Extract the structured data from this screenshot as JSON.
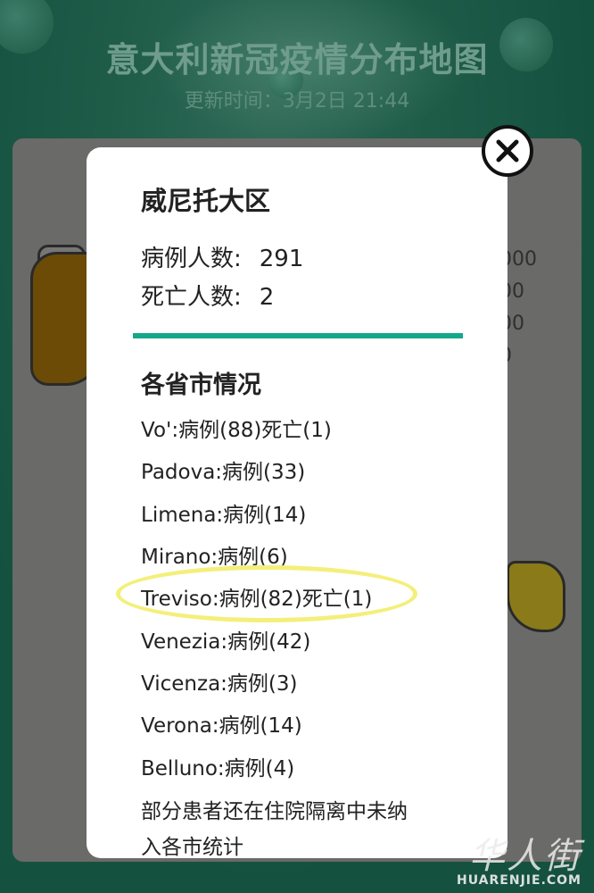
{
  "background": {
    "title": "意大利新冠疫情分布地图",
    "subtitle": "更新时间：3月2日 21:44",
    "legend_numbers": [
      "000",
      "00",
      "00",
      "0"
    ]
  },
  "modal": {
    "region_title": "威尼托大区",
    "cases_label": "病例人数:",
    "cases_value": "291",
    "deaths_label": "死亡人数:",
    "deaths_value": "2",
    "section_title": "各省市情况",
    "cities": [
      "Vo':病例(88)死亡(1)",
      "Padova:病例(33)",
      "Limena:病例(14)",
      "Mirano:病例(6)",
      "Treviso:病例(82)死亡(1)",
      "Venezia:病例(42)",
      "Vicenza:病例(3)",
      "Verona:病例(14)",
      "Belluno:病例(4)"
    ],
    "note_line1": "部分患者还在住院隔离中未纳",
    "note_line2": "入各市统计",
    "highlighted_city_index": 4
  },
  "watermark": {
    "text_cn": "华人街",
    "text_en": "HUARENJIE.COM"
  },
  "colors": {
    "divider": "#14a88a",
    "highlight_ring": "#f4ef7a",
    "background_green": "#1e5c48"
  },
  "icons": {
    "close": "close-icon"
  }
}
